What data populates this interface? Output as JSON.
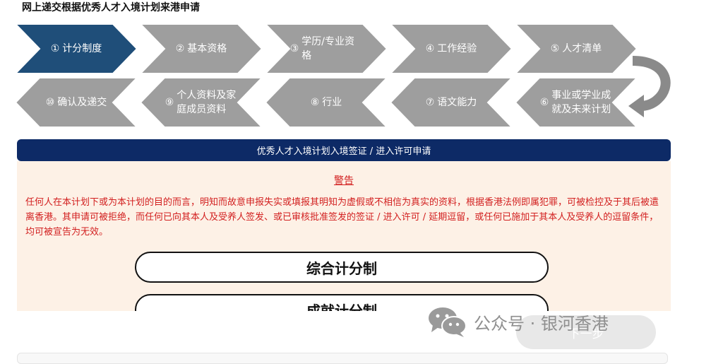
{
  "page": {
    "title": "网上递交根据优秀人才入境计划来港申请"
  },
  "steps": [
    {
      "num": "①",
      "label": "计分制度",
      "active": true
    },
    {
      "num": "②",
      "label": "基本资格"
    },
    {
      "num": "③",
      "label": "学历/专业资格"
    },
    {
      "num": "④",
      "label": "工作经验"
    },
    {
      "num": "⑤",
      "label": "人才清单"
    },
    {
      "num": "⑥",
      "label": "事业或学业成就及未来计划"
    },
    {
      "num": "⑦",
      "label": "语文能力"
    },
    {
      "num": "⑧",
      "label": "行业"
    },
    {
      "num": "⑨",
      "label": "个人资料及家庭成员资料"
    },
    {
      "num": "⑩",
      "label": "确认及递交"
    }
  ],
  "panel": {
    "header": "优秀人才入境计划入境签证 / 进入许可申请",
    "warning_title": "警告",
    "warning_text": "任何人在本计划下或为本计划的目的而言，明知而故意申报失实或填报其明知为虚假或不相信为真实的资料，根据香港法例即属犯罪，可被检控及于其后被遣离香港。其申请可被拒绝，而任何已向其本人及受养人签发、或已审核批准签发的签证 / 进入许可 / 延期逗留，或任何已施加于其本人及受养人的逗留条件，均可被宣告为无效。",
    "scheme_general": "综合计分制",
    "scheme_achievement": "成就计分制"
  },
  "footer": {
    "next_label": "下一步"
  },
  "watermark": {
    "text": "公众号 · 银河香港"
  },
  "colors": {
    "active_step": "#1f4e79",
    "inactive_step": "#9e9e9e",
    "header_bg": "#0d2a66",
    "warning": "#d21f1f",
    "panel_bg": "#fdf1e6"
  }
}
